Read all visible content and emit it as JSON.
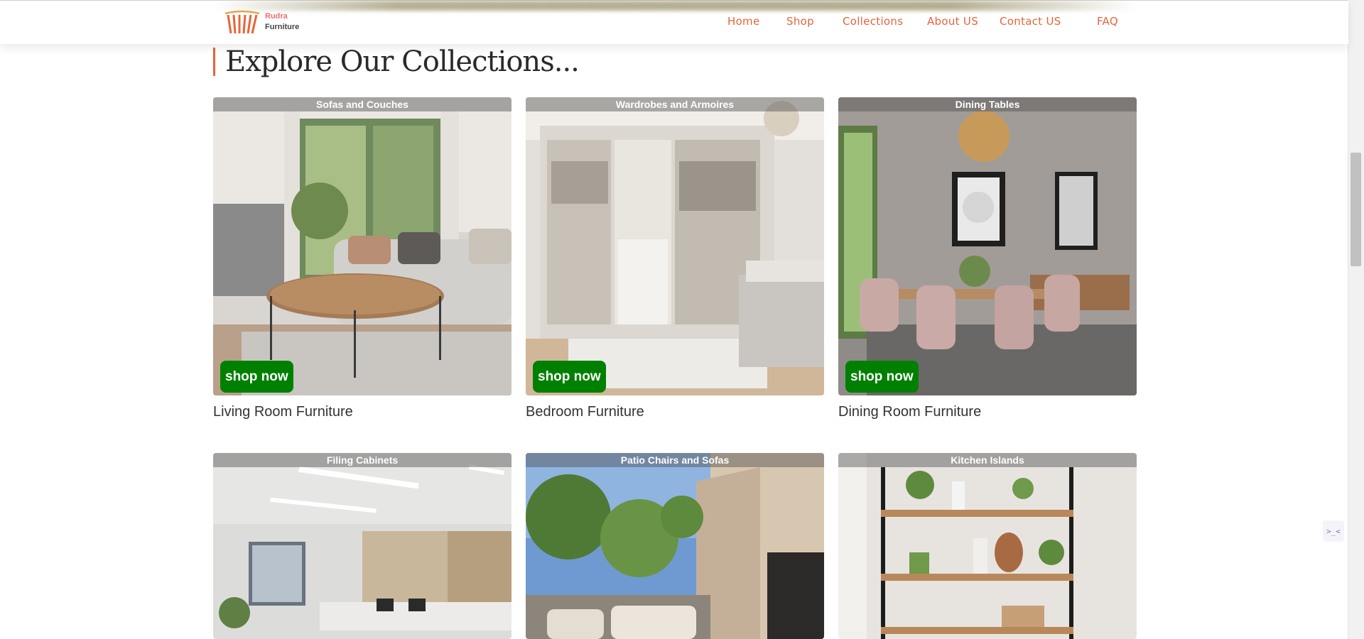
{
  "brand": {
    "line1": "Rudra",
    "line2": "Furniture"
  },
  "nav": [
    {
      "label": "Home"
    },
    {
      "label": "Shop"
    },
    {
      "label": "Collections"
    },
    {
      "label": "About US"
    },
    {
      "label": "Contact US"
    },
    {
      "label": "FAQ"
    }
  ],
  "section": {
    "heading": "Explore Our Collections..."
  },
  "cards": [
    {
      "overlay": "Sofas and Couches",
      "button": "shop now",
      "title": "Living Room Furniture"
    },
    {
      "overlay": "Wardrobes and Armoires",
      "button": "shop now",
      "title": "Bedroom Furniture"
    },
    {
      "overlay": "Dining Tables",
      "button": "shop now",
      "title": "Dining Room Furniture"
    },
    {
      "overlay": "Filing Cabinets"
    },
    {
      "overlay": "Patio Chairs and Sofas"
    },
    {
      "overlay": "Kitchen Islands"
    }
  ],
  "widget": {
    "icon": "chat-widget-icon",
    "glyph": ">_<"
  },
  "colors": {
    "accent": "#e8643a",
    "button": "#008000",
    "brand_red": "#f26d6d"
  }
}
